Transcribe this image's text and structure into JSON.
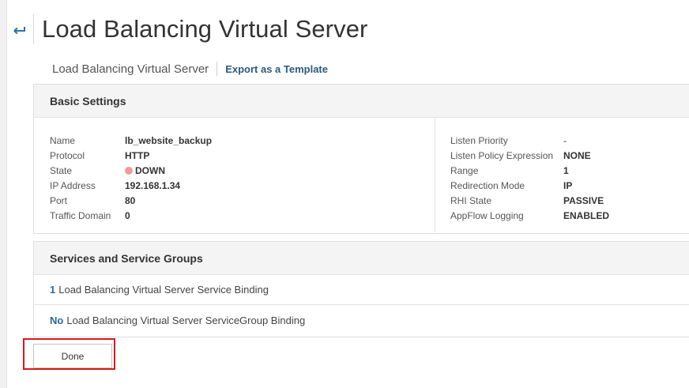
{
  "header": {
    "title": "Load Balancing Virtual Server",
    "back_icon": "back-arrow-icon"
  },
  "subnav": {
    "title": "Load Balancing Virtual Server",
    "export_link": "Export as a Template"
  },
  "basic_settings": {
    "heading": "Basic Settings",
    "left": [
      {
        "label": "Name",
        "value": "lb_website_backup"
      },
      {
        "label": "Protocol",
        "value": "HTTP"
      },
      {
        "label": "State",
        "value": "DOWN",
        "status_color": "#ee9c9c"
      },
      {
        "label": "IP Address",
        "value": "192.168.1.34"
      },
      {
        "label": "Port",
        "value": "80"
      },
      {
        "label": "Traffic Domain",
        "value": "0"
      }
    ],
    "right": [
      {
        "label": "Listen Priority",
        "value": "-"
      },
      {
        "label": "Listen Policy Expression",
        "value": "NONE"
      },
      {
        "label": "Range",
        "value": "1"
      },
      {
        "label": "Redirection Mode",
        "value": "IP"
      },
      {
        "label": "RHI State",
        "value": "PASSIVE"
      },
      {
        "label": "AppFlow Logging",
        "value": "ENABLED"
      }
    ]
  },
  "services": {
    "heading": "Services and Service Groups",
    "rows": [
      {
        "count": "1",
        "label": "Load Balancing Virtual Server Service Binding"
      },
      {
        "count": "No",
        "label": "Load Balancing Virtual Server ServiceGroup Binding"
      }
    ]
  },
  "actions": {
    "done_label": "Done",
    "highlight_color": "#d71a1a"
  },
  "colors": {
    "link": "#2c5a7e",
    "accent": "#2a6aa1",
    "status_down": "#ee9c9c"
  }
}
